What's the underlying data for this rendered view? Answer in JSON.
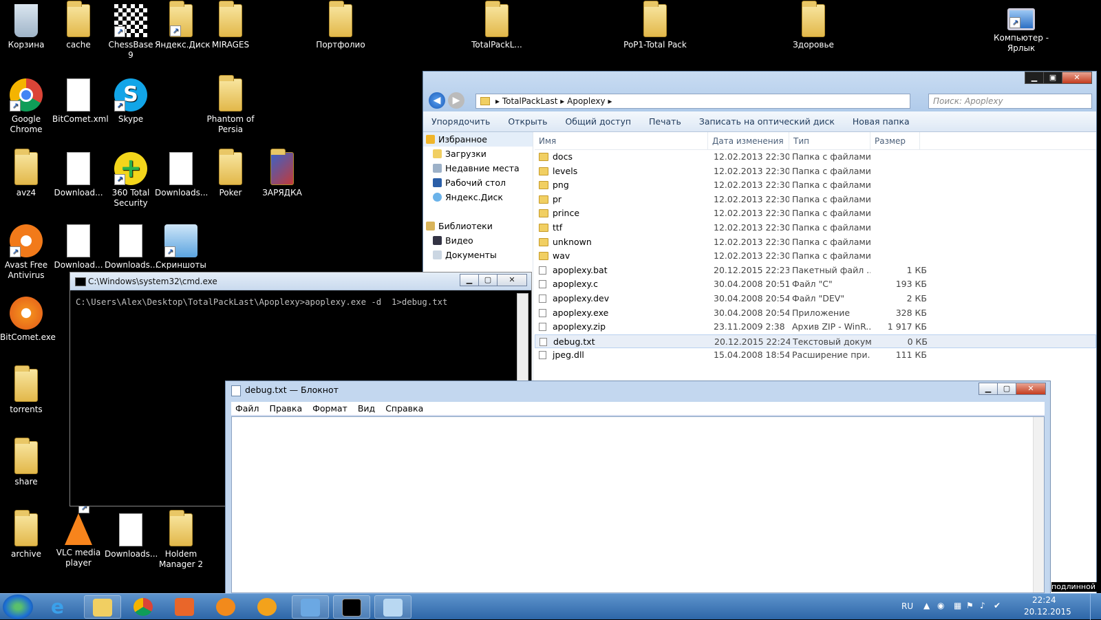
{
  "desktop": {
    "icons": [
      {
        "label": "Корзина",
        "icon": "recycle-bin-icon"
      },
      {
        "label": "cache",
        "icon": "folder-icon"
      },
      {
        "label": "ChessBase 9",
        "icon": "chessbase-icon"
      },
      {
        "label": "Яндекс.Диск",
        "icon": "yandex-disk-icon"
      },
      {
        "label": "MIRAGES",
        "icon": "folder-icon"
      },
      {
        "label": "Портфолио",
        "icon": "folder-icon"
      },
      {
        "label": "TotalPackL...",
        "icon": "folder-icon"
      },
      {
        "label": "PoP1-Total Pack",
        "icon": "folder-icon"
      },
      {
        "label": "Здоровье",
        "icon": "folder-icon"
      },
      {
        "label": "Компьютер - Ярлык",
        "icon": "computer-icon"
      },
      {
        "label": "Google Chrome",
        "icon": "chrome-icon"
      },
      {
        "label": "BitComet.xml",
        "icon": "xml-file-icon"
      },
      {
        "label": "Skype",
        "icon": "skype-icon"
      },
      {
        "label": "Phantom of Persia",
        "icon": "folder-icon"
      },
      {
        "label": "avz4",
        "icon": "folder-icon"
      },
      {
        "label": "Download...",
        "icon": "file-icon"
      },
      {
        "label": "360 Total Security",
        "icon": "security-icon"
      },
      {
        "label": "Downloads...",
        "icon": "file-icon"
      },
      {
        "label": "Poker",
        "icon": "folder-icon"
      },
      {
        "label": "ЗАРЯДКА",
        "icon": "folder-icon"
      },
      {
        "label": "Avast Free Antivirus",
        "icon": "avast-icon"
      },
      {
        "label": "Download...",
        "icon": "file-icon"
      },
      {
        "label": "Downloads...",
        "icon": "file-icon"
      },
      {
        "label": "Скриншоты",
        "icon": "screenshots-icon"
      },
      {
        "label": "BitComet.exe",
        "icon": "bitcomet-icon"
      },
      {
        "label": "torrents",
        "icon": "folder-icon"
      },
      {
        "label": "share",
        "icon": "folder-icon"
      },
      {
        "label": "archive",
        "icon": "folder-icon"
      },
      {
        "label": "VLC media player",
        "icon": "vlc-icon"
      },
      {
        "label": "Downloads...",
        "icon": "file-icon"
      },
      {
        "label": "Holdem Manager 2",
        "icon": "folder-icon"
      }
    ]
  },
  "explorer": {
    "address": [
      "TotalPackLast",
      "Apoplexy"
    ],
    "search_placeholder": "Поиск: Apoplexy",
    "toolbar": [
      "Упорядочить",
      "Открыть",
      "Общий доступ",
      "Печать",
      "Записать на оптический диск",
      "Новая папка"
    ],
    "nav": [
      {
        "label": "Избранное",
        "top": true
      },
      {
        "label": "Загрузки"
      },
      {
        "label": "Недавние места"
      },
      {
        "label": "Рабочий стол"
      },
      {
        "label": "Яндекс.Диск"
      },
      {
        "label": "",
        "spacer": true
      },
      {
        "label": "Библиотеки",
        "top": true
      },
      {
        "label": "Видео"
      },
      {
        "label": "Документы"
      }
    ],
    "columns": [
      "Имя",
      "Дата изменения",
      "Тип",
      "Размер"
    ],
    "files": [
      {
        "name": "docs",
        "date": "12.02.2013 22:30",
        "type": "Папка с файлами",
        "size": "",
        "kind": "folder"
      },
      {
        "name": "levels",
        "date": "12.02.2013 22:30",
        "type": "Папка с файлами",
        "size": "",
        "kind": "folder"
      },
      {
        "name": "png",
        "date": "12.02.2013 22:30",
        "type": "Папка с файлами",
        "size": "",
        "kind": "folder"
      },
      {
        "name": "pr",
        "date": "12.02.2013 22:30",
        "type": "Папка с файлами",
        "size": "",
        "kind": "folder"
      },
      {
        "name": "prince",
        "date": "12.02.2013 22:30",
        "type": "Папка с файлами",
        "size": "",
        "kind": "folder"
      },
      {
        "name": "ttf",
        "date": "12.02.2013 22:30",
        "type": "Папка с файлами",
        "size": "",
        "kind": "folder"
      },
      {
        "name": "unknown",
        "date": "12.02.2013 22:30",
        "type": "Папка с файлами",
        "size": "",
        "kind": "folder"
      },
      {
        "name": "wav",
        "date": "12.02.2013 22:30",
        "type": "Папка с файлами",
        "size": "",
        "kind": "folder"
      },
      {
        "name": "apoplexy.bat",
        "date": "20.12.2015 22:23",
        "type": "Пакетный файл ...",
        "size": "1 КБ",
        "kind": "file"
      },
      {
        "name": "apoplexy.c",
        "date": "30.04.2008 20:51",
        "type": "Файл \"C\"",
        "size": "193 КБ",
        "kind": "file"
      },
      {
        "name": "apoplexy.dev",
        "date": "30.04.2008 20:54",
        "type": "Файл \"DEV\"",
        "size": "2 КБ",
        "kind": "file"
      },
      {
        "name": "apoplexy.exe",
        "date": "30.04.2008 20:54",
        "type": "Приложение",
        "size": "328 КБ",
        "kind": "file"
      },
      {
        "name": "apoplexy.zip",
        "date": "23.11.2009 2:38",
        "type": "Архив ZIP - WinR...",
        "size": "1 917 КБ",
        "kind": "file"
      },
      {
        "name": "debug.txt",
        "date": "20.12.2015 22:24",
        "type": "Текстовый докум...",
        "size": "0 КБ",
        "kind": "file",
        "selected": true
      },
      {
        "name": "jpeg.dll",
        "date": "15.04.2008 18:54",
        "type": "Расширение при...",
        "size": "111 КБ",
        "kind": "file"
      }
    ]
  },
  "cmd": {
    "title": "C:\\Windows\\system32\\cmd.exe",
    "line": "C:\\Users\\Alex\\Desktop\\TotalPackLast\\Apoplexy>apoplexy.exe -d  1>debug.txt"
  },
  "notepad": {
    "title": "debug.txt — Блокнот",
    "menu": [
      "Файл",
      "Правка",
      "Формат",
      "Вид",
      "Справка"
    ]
  },
  "taskbar": {
    "lang": "RU",
    "time": "22:24",
    "date": "20.12.2015",
    "apps": [
      "explorer-icon",
      "ie-icon",
      "folder-icon",
      "chrome-icon",
      "media-player-icon",
      "bitcomet-icon",
      "kolobok-icon",
      "remote-icon",
      "cmd-icon",
      "notepad-icon"
    ]
  },
  "desktop_partial": "подлинной"
}
